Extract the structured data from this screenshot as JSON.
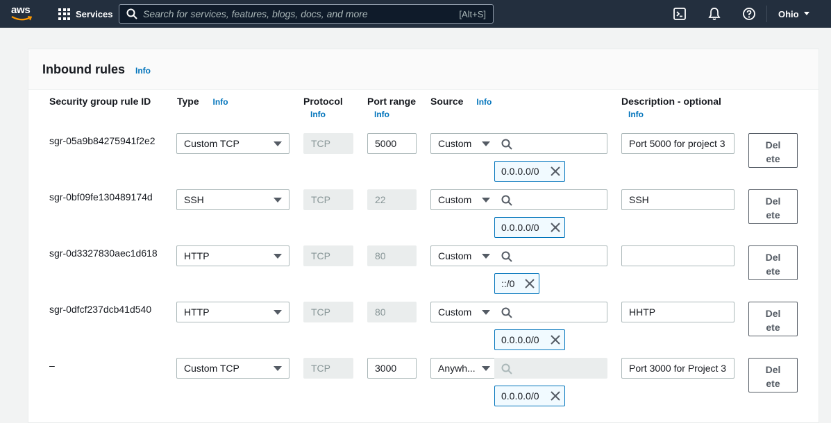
{
  "nav": {
    "logo_text": "aws",
    "services_label": "Services",
    "search_placeholder": "Search for services, features, blogs, docs, and more",
    "search_shortcut": "[Alt+S]",
    "region": "Ohio"
  },
  "panel": {
    "title": "Inbound rules",
    "info": "Info"
  },
  "columns": {
    "rule_id": "Security group rule ID",
    "type": "Type",
    "protocol": "Protocol",
    "port_range": "Port range",
    "source": "Source",
    "description": "Description - optional",
    "info": "Info"
  },
  "rules": [
    {
      "id": "sgr-05a9b84275941f2e2",
      "type": "Custom TCP",
      "protocol": "TCP",
      "port": "5000",
      "source": "Custom",
      "cidr": "0.0.0.0/0",
      "description": "Port 5000 for project 3",
      "delete": [
        "Del",
        "ete"
      ]
    },
    {
      "id": "sgr-0bf09fe130489174d",
      "type": "SSH",
      "protocol": "TCP",
      "port": "22",
      "source": "Custom",
      "cidr": "0.0.0.0/0",
      "description": "SSH",
      "delete": [
        "Del",
        "ete"
      ]
    },
    {
      "id": "sgr-0d3327830aec1d618",
      "type": "HTTP",
      "protocol": "TCP",
      "port": "80",
      "source": "Custom",
      "cidr": "::/0",
      "description": "",
      "delete": [
        "Del",
        "ete"
      ]
    },
    {
      "id": "sgr-0dfcf237dcb41d540",
      "type": "HTTP",
      "protocol": "TCP",
      "port": "80",
      "source": "Custom",
      "cidr": "0.0.0.0/0",
      "description": "HHTP",
      "delete": [
        "Del",
        "ete"
      ]
    },
    {
      "id": "–",
      "type": "Custom TCP",
      "protocol": "TCP",
      "port": "3000",
      "source": "Anywh...",
      "cidr": "0.0.0.0/0",
      "description": "Port 3000 for Project 3",
      "delete": [
        "Del",
        "ete"
      ]
    }
  ]
}
